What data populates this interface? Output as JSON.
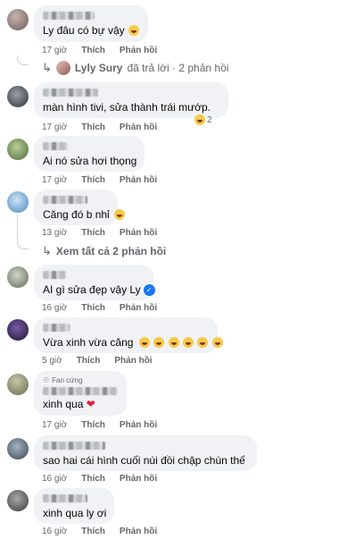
{
  "comments": [
    {
      "id": 1,
      "text": "Ly đâu có bự vậy",
      "time": "17 giờ",
      "like": "Thích",
      "reply": "Phản hồi",
      "emoji_count": 1,
      "avatar_color": "#6b5a58"
    },
    {
      "id": 2,
      "text": "màn hình tivi, sửa thành trái mướp.",
      "time": "17 giờ",
      "like": "Thích",
      "reply": "Phản hồi",
      "reaction_count": "2",
      "avatar_color": "#4a4e56"
    },
    {
      "id": 3,
      "text": "Ai nó sửa hơi thọng",
      "time": "17 giờ",
      "like": "Thích",
      "reply": "Phản hồi",
      "avatar_color": "#6d8a4e"
    },
    {
      "id": 4,
      "text": "Căng đó b nhỉ",
      "time": "13 giờ",
      "like": "Thích",
      "reply": "Phản hồi",
      "emoji_count": 1,
      "avatar_color": "#6aa6d9"
    },
    {
      "id": 5,
      "text": "AI gì sửa đẹp vậy Ly",
      "time": "16 giờ",
      "like": "Thích",
      "reply": "Phản hồi",
      "like_badge": "👍",
      "avatar_color": "#7d8a7a"
    },
    {
      "id": 6,
      "text": "Vừa xinh vừa căng",
      "time": "5 giờ",
      "like": "Thích",
      "reply": "Phản hồi",
      "emoji_count": 6,
      "avatar_color": "#3b2a5a"
    },
    {
      "id": 7,
      "badge": "Fan cứng",
      "text": "xinh qua",
      "time": "17 giờ",
      "like": "Thích",
      "reply": "Phản hồi",
      "heart": "❤",
      "avatar_color": "#8a8a70"
    },
    {
      "id": 8,
      "text": "sao hai cái hình cuối núi đồi chập chùn thế",
      "time": "16 giờ",
      "like": "Thích",
      "reply": "Phản hồi",
      "avatar_color": "#5f6e7d"
    },
    {
      "id": 9,
      "text": "xinh qua ly ơi",
      "time": "16 giờ",
      "like": "Thích",
      "reply": "Phản hồi",
      "avatar_color": "#5b5b5b"
    }
  ],
  "reply_threads": [
    {
      "name": "Lyly Sury",
      "text": "đã trả lời · 2 phản hồi"
    },
    {
      "text": "Xem tất cả 2 phản hồi"
    }
  ],
  "icons": {
    "reply_arrow": "↳",
    "fan_icon": "☉",
    "like_badge": "👍"
  },
  "colors": {
    "bubble": "#f0f2f5",
    "meta": "#65676b",
    "link": "#65676b",
    "like_blue": "#1877f2",
    "heart_red": "#e41e3f"
  }
}
